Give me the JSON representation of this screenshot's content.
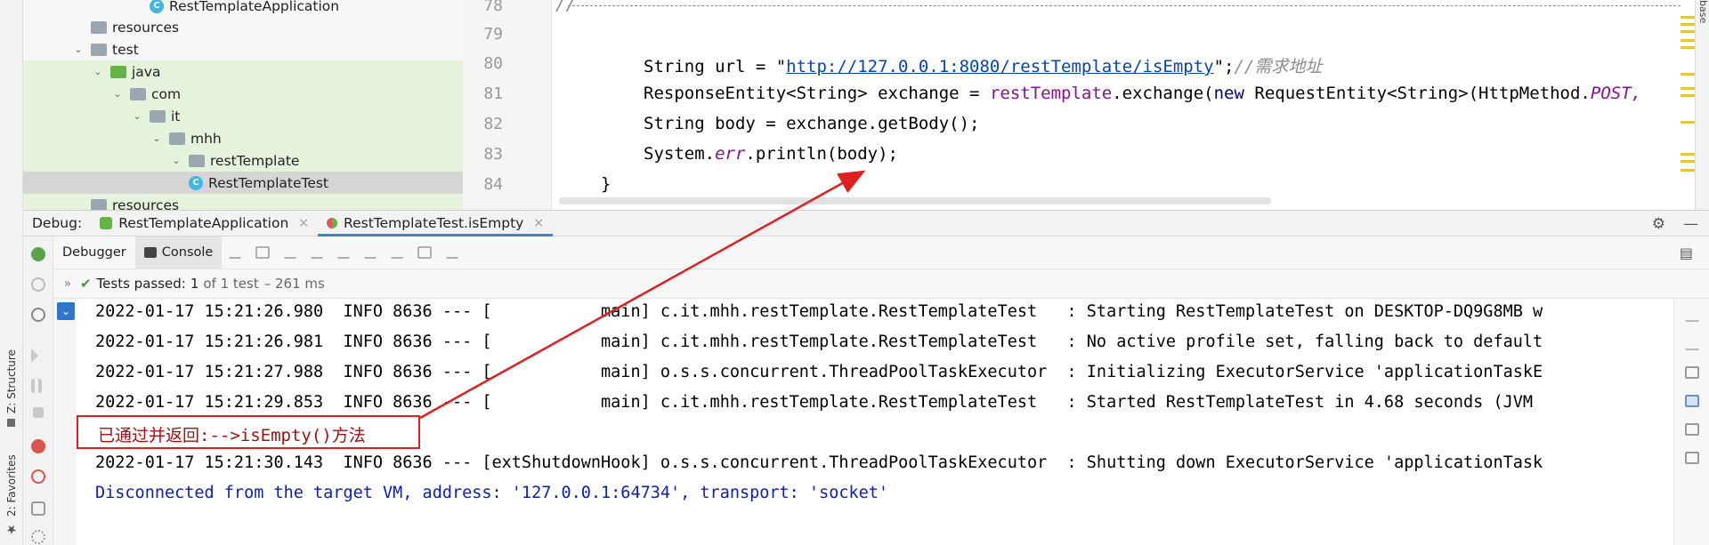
{
  "left_edge": {
    "structure_label": "Z: Structure",
    "favorites_label": "2: Favorites"
  },
  "project_tree": {
    "rows": [
      {
        "label": "RestTemplateApplication",
        "type": "class",
        "indent": 7
      },
      {
        "label": "resources",
        "type": "folder-res",
        "indent": 4
      },
      {
        "label": "test",
        "type": "folder",
        "indent": 3,
        "expanded": true
      },
      {
        "label": "java",
        "type": "folder-green",
        "indent": 4,
        "expanded": true
      },
      {
        "label": "com",
        "type": "folder",
        "indent": 5,
        "expanded": true
      },
      {
        "label": "it",
        "type": "folder",
        "indent": 6,
        "expanded": true
      },
      {
        "label": "mhh",
        "type": "folder",
        "indent": 7,
        "expanded": true
      },
      {
        "label": "restTemplate",
        "type": "folder",
        "indent": 8,
        "expanded": true
      },
      {
        "label": "RestTemplateTest",
        "type": "class",
        "indent": 9
      },
      {
        "label": "resources",
        "type": "folder-res",
        "indent": 4
      }
    ]
  },
  "editor": {
    "line_numbers": [
      "78",
      "79",
      "80",
      "81",
      "82",
      "83",
      "84"
    ],
    "dashes_prefix": "//",
    "line80": {
      "prefix": "String url = \"",
      "url": "http://127.0.0.1:8080/restTemplate/isEmpty",
      "suffix": "\";",
      "comment": "//需求地址"
    },
    "line81": {
      "a": "ResponseEntity<String> exchange = ",
      "field": "restTemplate",
      "b": ".exchange(",
      "kw": "new",
      "c": " RequestEntity<String>(HttpMethod.",
      "d": "POST,"
    },
    "line82": "String body = exchange.getBody();",
    "line83": {
      "a": "System.",
      "field": "err",
      "b": ".println(body);"
    },
    "line84": "}",
    "right_strip_label": "base"
  },
  "debug": {
    "label": "Debug:",
    "tabs": [
      {
        "label": "RestTemplateApplication",
        "close": "×"
      },
      {
        "label": "RestTemplateTest.isEmpty",
        "close": "×"
      }
    ],
    "subtabs": {
      "debugger": "Debugger",
      "console": "Console"
    },
    "tests": {
      "check": "✔",
      "passed": "Tests passed:",
      "count": "1",
      "of": "of 1 test",
      "time": "– 261 ms"
    }
  },
  "console": {
    "lines": [
      "2022-01-17 15:21:26.980  INFO 8636 --- [           main] c.it.mhh.restTemplate.RestTemplateTest   : Starting RestTemplateTest on DESKTOP-DQ9G8MB w",
      "2022-01-17 15:21:26.981  INFO 8636 --- [           main] c.it.mhh.restTemplate.RestTemplateTest   : No active profile set, falling back to default",
      "2022-01-17 15:21:27.988  INFO 8636 --- [           main] o.s.s.concurrent.ThreadPoolTaskExecutor  : Initializing ExecutorService 'applicationTaskE",
      "2022-01-17 15:21:29.853  INFO 8636 --- [           main] c.it.mhh.restTemplate.RestTemplateTest   : Started RestTemplateTest in 4.68 seconds (JVM ",
      "",
      "2022-01-17 15:21:30.143  INFO 8636 --- [extShutdownHook] o.s.s.concurrent.ThreadPoolTaskExecutor  : Shutting down ExecutorService 'applicationTask"
    ],
    "disconnected": "Disconnected from the target VM, address: '127.0.0.1:64734', transport: 'socket'",
    "annotation": "已通过并返回:-->isEmpty()方法"
  },
  "colors": {
    "annotation_border": "#e02020",
    "active_tab_underline": "#4083c9",
    "tests_passed_check": "#3c9a3c"
  }
}
